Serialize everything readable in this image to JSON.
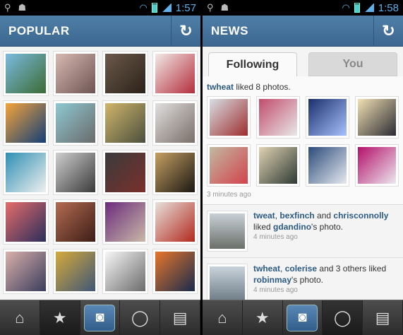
{
  "left": {
    "status": {
      "time": "1:57"
    },
    "title": "POPULAR",
    "tiles": [
      {
        "c1": "#7bbbe0",
        "c2": "#3c6b34"
      },
      {
        "c1": "#d8b9b2",
        "c2": "#6d5452"
      },
      {
        "c1": "#6c5a4c",
        "c2": "#2b2118"
      },
      {
        "c1": "#f1e9e6",
        "c2": "#b42d3c"
      },
      {
        "c1": "#f5a43a",
        "c2": "#123e78"
      },
      {
        "c1": "#8ec9d3",
        "c2": "#6a6a6a"
      },
      {
        "c1": "#d1b56c",
        "c2": "#4a4f3c"
      },
      {
        "c1": "#e0dfdf",
        "c2": "#7a6e68"
      },
      {
        "c1": "#2e8fb3",
        "c2": "#f0f0f0"
      },
      {
        "c1": "#cfcfcf",
        "c2": "#3a3a3a"
      },
      {
        "c1": "#3a3b3d",
        "c2": "#7a2f2a"
      },
      {
        "c1": "#c6a064",
        "c2": "#1b1712"
      },
      {
        "c1": "#e66d6b",
        "c2": "#2b2d5c"
      },
      {
        "c1": "#b46b52",
        "c2": "#3c1d16"
      },
      {
        "c1": "#6c2b7c",
        "c2": "#c8b9a8"
      },
      {
        "c1": "#e8e1dc",
        "c2": "#b1291d"
      },
      {
        "c1": "#d9b1ab",
        "c2": "#3a3c5c"
      },
      {
        "c1": "#d6aa3a",
        "c2": "#3f5676"
      },
      {
        "c1": "#f7f7f7",
        "c2": "#6b6b6b"
      },
      {
        "c1": "#e8762c",
        "c2": "#182b4b"
      }
    ]
  },
  "right": {
    "status": {
      "time": "1:58"
    },
    "title": "NEWS",
    "tabs": {
      "following": "Following",
      "you": "You"
    },
    "story1": {
      "user": "twheat",
      "text": "liked 8 photos.",
      "ago": "3 minutes ago"
    },
    "thumbs": [
      {
        "c1": "#d8dfe5",
        "c2": "#9e2d2d"
      },
      {
        "c1": "#c24c6d",
        "c2": "#e8e8e8"
      },
      {
        "c1": "#1a2e6b",
        "c2": "#a8c3ff"
      },
      {
        "c1": "#f1e1b3",
        "c2": "#2b2a33"
      },
      {
        "c1": "#c2b9a3",
        "c2": "#d2434b"
      },
      {
        "c1": "#e1d2b3",
        "c2": "#2d3a33"
      },
      {
        "c1": "#2b4b7a",
        "c2": "#e6e9ef"
      },
      {
        "c1": "#b30f68",
        "c2": "#ece8f0"
      }
    ],
    "story2": {
      "user1": "tweat",
      "user2": "bexfinch",
      "and": "and",
      "user3": "chrisconnolly",
      "liked": "liked",
      "target": "gdandino",
      "tail": "'s photo.",
      "ago": "4 minutes ago",
      "thumb": {
        "c1": "#c9d1d7",
        "c2": "#6b6f6a"
      }
    },
    "story3": {
      "user1": "twheat",
      "user2": "colerise",
      "and": "and 3 others liked",
      "target": "robinmay",
      "tail": "'s photo.",
      "ago": "4 minutes ago",
      "thumb": {
        "c1": "#c9d3dc",
        "c2": "#6b7a84"
      }
    }
  },
  "icons": {
    "refresh": "refresh-icon",
    "home": "home-icon",
    "star": "star-icon",
    "camera": "camera-icon",
    "chat": "chat-bubble-icon",
    "profile": "profile-card-icon"
  }
}
